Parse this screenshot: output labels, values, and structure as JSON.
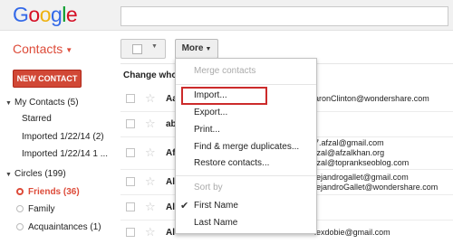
{
  "app": {
    "logo_letters": [
      {
        "ch": "G",
        "color": "#3369e8"
      },
      {
        "ch": "o",
        "color": "#d50f25"
      },
      {
        "ch": "o",
        "color": "#eeb211"
      },
      {
        "ch": "g",
        "color": "#3369e8"
      },
      {
        "ch": "l",
        "color": "#009925"
      },
      {
        "ch": "e",
        "color": "#d50f25"
      }
    ],
    "section_title": "Contacts",
    "accent_color": "#dd4b39"
  },
  "toolbar": {
    "more_label": "More"
  },
  "sidebar": {
    "new_contact_label": "NEW CONTACT",
    "my_contacts_label": "My Contacts (5)",
    "items": [
      {
        "label": "Starred"
      },
      {
        "label": "Imported 1/22/14 (2)"
      },
      {
        "label": "Imported 1/22/14 1 ..."
      }
    ],
    "circles_label": "Circles (199)",
    "circles": [
      {
        "label": "Friends (36)",
        "active": true
      },
      {
        "label": "Family",
        "active": false
      },
      {
        "label": "Acquaintances (1)",
        "active": false
      }
    ]
  },
  "list": {
    "change_who_label": "Change who's",
    "rows": [
      {
        "name": "Aa",
        "emails": [
          "aronClinton@wondershare.com"
        ]
      },
      {
        "name": "ab",
        "emails": []
      },
      {
        "name": "Af",
        "emails": [
          "7.afzal@gmail.com",
          "fzal@afzalkhan.org",
          "fzal@toprankseoblog.com"
        ]
      },
      {
        "name": "Al",
        "emails": [
          "lejandrogallet@gmail.com",
          "lejandroGallet@wondershare.com"
        ]
      },
      {
        "name": "Al",
        "emails": []
      },
      {
        "name": "Al",
        "emails": [
          "lexdobie@gmail.com"
        ]
      }
    ]
  },
  "menu": {
    "merge_contacts": "Merge contacts",
    "import": "Import...",
    "export": "Export...",
    "print": "Print...",
    "find_merge": "Find & merge duplicates...",
    "restore": "Restore contacts...",
    "sort_by": "Sort by",
    "first_name": "First Name",
    "last_name": "Last Name"
  }
}
